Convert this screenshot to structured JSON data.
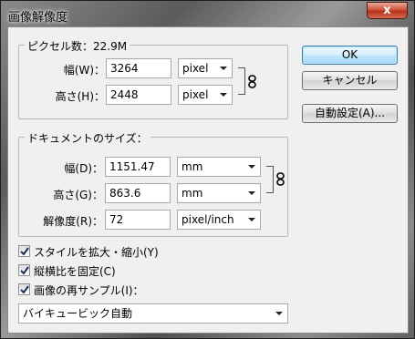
{
  "window": {
    "title": "画像解像度",
    "close_glyph": "x"
  },
  "pixel_group": {
    "title": "ピクセル数：22.9M",
    "width": {
      "label": "幅(W)：",
      "value": "3264",
      "unit": "pixel"
    },
    "height": {
      "label": "高さ(H)：",
      "value": "2448",
      "unit": "pixel"
    }
  },
  "document_group": {
    "title": "ドキュメントのサイズ：",
    "width": {
      "label": "幅(D)：",
      "value": "1151.47",
      "unit": "mm"
    },
    "height": {
      "label": "高さ(G)：",
      "value": "863.6",
      "unit": "mm"
    },
    "resolution": {
      "label": "解像度(R)：",
      "value": "72",
      "unit": "pixel/inch"
    }
  },
  "options": [
    {
      "label": "スタイルを拡大・縮小(Y)",
      "checked": true
    },
    {
      "label": "縦横比を固定(C)",
      "checked": true
    },
    {
      "label": "画像の再サンプル(I)：",
      "checked": true
    }
  ],
  "resample_method": "バイキュービック自動",
  "buttons": {
    "ok": "OK",
    "cancel": "キャンセル",
    "auto": "自動設定(A)..."
  },
  "icons": {
    "chain": "chain-link-icon",
    "dropdown": "chevron-down-icon",
    "check": "checkmark-icon"
  }
}
